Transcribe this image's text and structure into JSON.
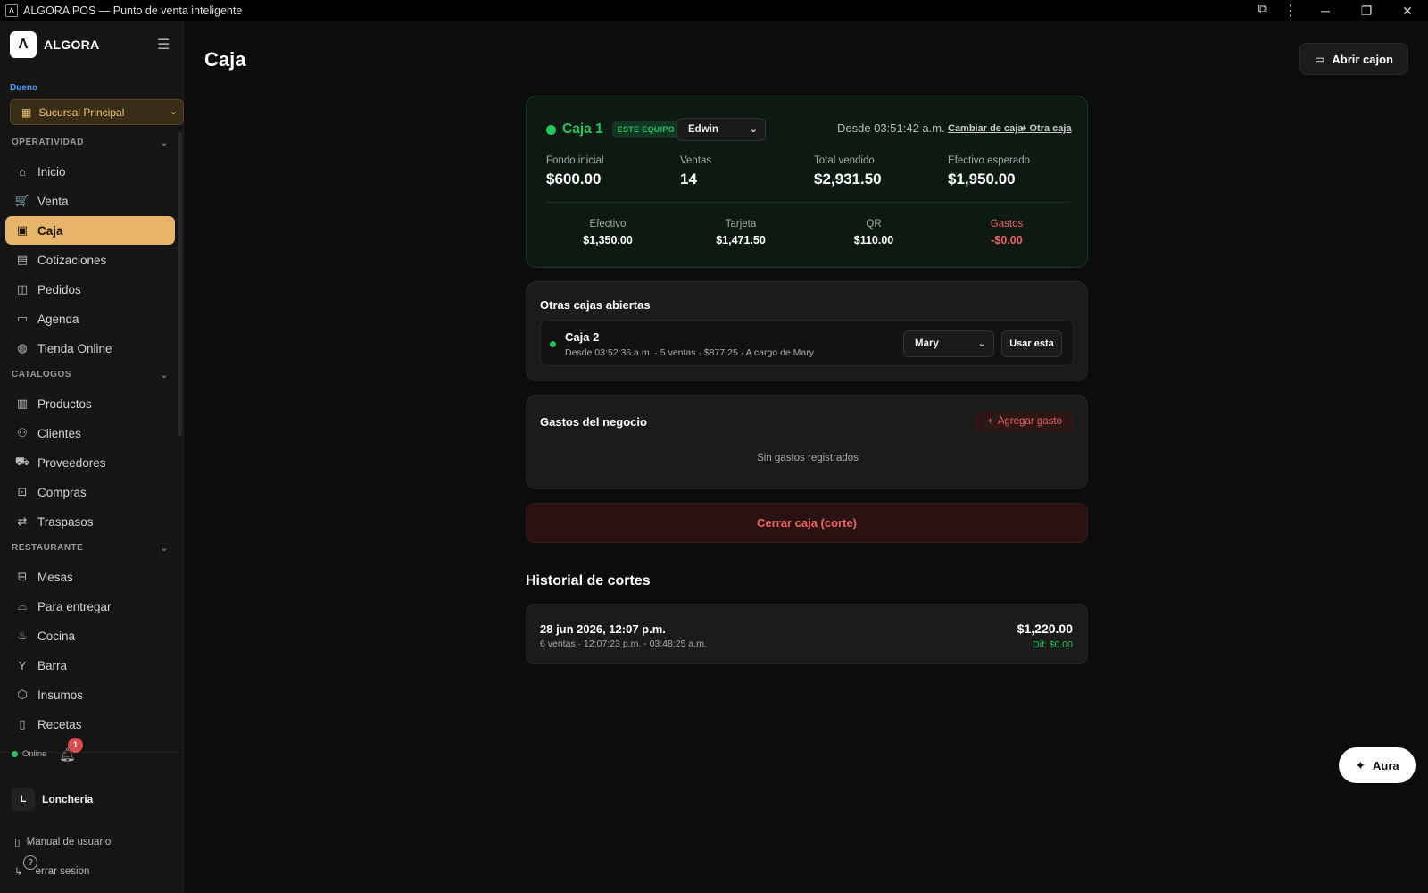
{
  "window": {
    "title": "ALGORA POS — Punto de venta inteligente"
  },
  "brand": {
    "logo": "Λ",
    "name": "ALGORA"
  },
  "sidebar": {
    "role": "Dueno",
    "branch": "Sucursal Principal",
    "sections": {
      "operatividad": "OPERATIVIDAD",
      "catalogos": "CATALOGOS",
      "restaurante": "RESTAURANTE"
    },
    "operatividad_items": [
      {
        "label": "Inicio",
        "icon": "home-icon"
      },
      {
        "label": "Venta",
        "icon": "cart-icon"
      },
      {
        "label": "Caja",
        "icon": "cash-register-icon",
        "active": true
      },
      {
        "label": "Cotizaciones",
        "icon": "document-icon"
      },
      {
        "label": "Pedidos",
        "icon": "bag-icon"
      },
      {
        "label": "Agenda",
        "icon": "calendar-icon"
      },
      {
        "label": "Tienda Online",
        "icon": "globe-icon"
      }
    ],
    "catalogos_items": [
      {
        "label": "Productos",
        "icon": "box-icon"
      },
      {
        "label": "Clientes",
        "icon": "users-icon"
      },
      {
        "label": "Proveedores",
        "icon": "truck-icon"
      },
      {
        "label": "Compras",
        "icon": "inbox-icon"
      },
      {
        "label": "Traspasos",
        "icon": "transfer-icon"
      }
    ],
    "restaurante_items": [
      {
        "label": "Mesas",
        "icon": "table-icon"
      },
      {
        "label": "Para entregar",
        "icon": "delivery-icon"
      },
      {
        "label": "Cocina",
        "icon": "chef-icon"
      },
      {
        "label": "Barra",
        "icon": "glass-icon"
      },
      {
        "label": "Insumos",
        "icon": "package-icon"
      },
      {
        "label": "Recetas",
        "icon": "book-icon"
      }
    ],
    "status": "Online",
    "notifications": "1",
    "user": {
      "initial": "L",
      "name": "Loncheria"
    },
    "manual": "Manual de usuario",
    "logout": "errar sesion"
  },
  "header": {
    "title": "Caja",
    "open_drawer": "Abrir cajon"
  },
  "current_register": {
    "name": "Caja 1",
    "chip": "ESTE EQUIPO",
    "cashier": "Edwin",
    "since": "Desde 03:51:42 a.m.",
    "change_link": "Cambiar de caja",
    "other_link": "+ Otra caja",
    "stats": [
      {
        "label": "Fondo inicial",
        "value": "$600.00"
      },
      {
        "label": "Ventas",
        "value": "14"
      },
      {
        "label": "Total vendido",
        "value": "$2,931.50"
      },
      {
        "label": "Efectivo esperado",
        "value": "$1,950.00"
      }
    ],
    "breakdown": [
      {
        "label": "Efectivo",
        "value": "$1,350.00"
      },
      {
        "label": "Tarjeta",
        "value": "$1,471.50"
      },
      {
        "label": "QR",
        "value": "$110.00"
      },
      {
        "label": "Gastos",
        "value": "-$0.00"
      }
    ]
  },
  "other_registers": {
    "title": "Otras cajas abiertas",
    "items": [
      {
        "name": "Caja 2",
        "meta": "Desde 03:52:36 a.m. · 5 ventas · $877.25 · A cargo de Mary",
        "cashier": "Mary",
        "use_label": "Usar esta"
      }
    ]
  },
  "expenses": {
    "title": "Gastos del negocio",
    "add_label": "Agregar gasto",
    "empty": "Sin gastos registrados"
  },
  "close_label": "Cerrar caja (corte)",
  "history": {
    "title": "Historial de cortes",
    "items": [
      {
        "date": "28 jun 2026, 12:07 p.m.",
        "meta": "6 ventas · 12:07:23 p.m. - 03:48:25 a.m.",
        "amount": "$1,220.00",
        "diff": "Dif: $0.00"
      }
    ]
  },
  "aura_label": "Aura",
  "colors": {
    "accent": "#e6b56a",
    "success": "#22c55e",
    "danger": "#f06262"
  }
}
